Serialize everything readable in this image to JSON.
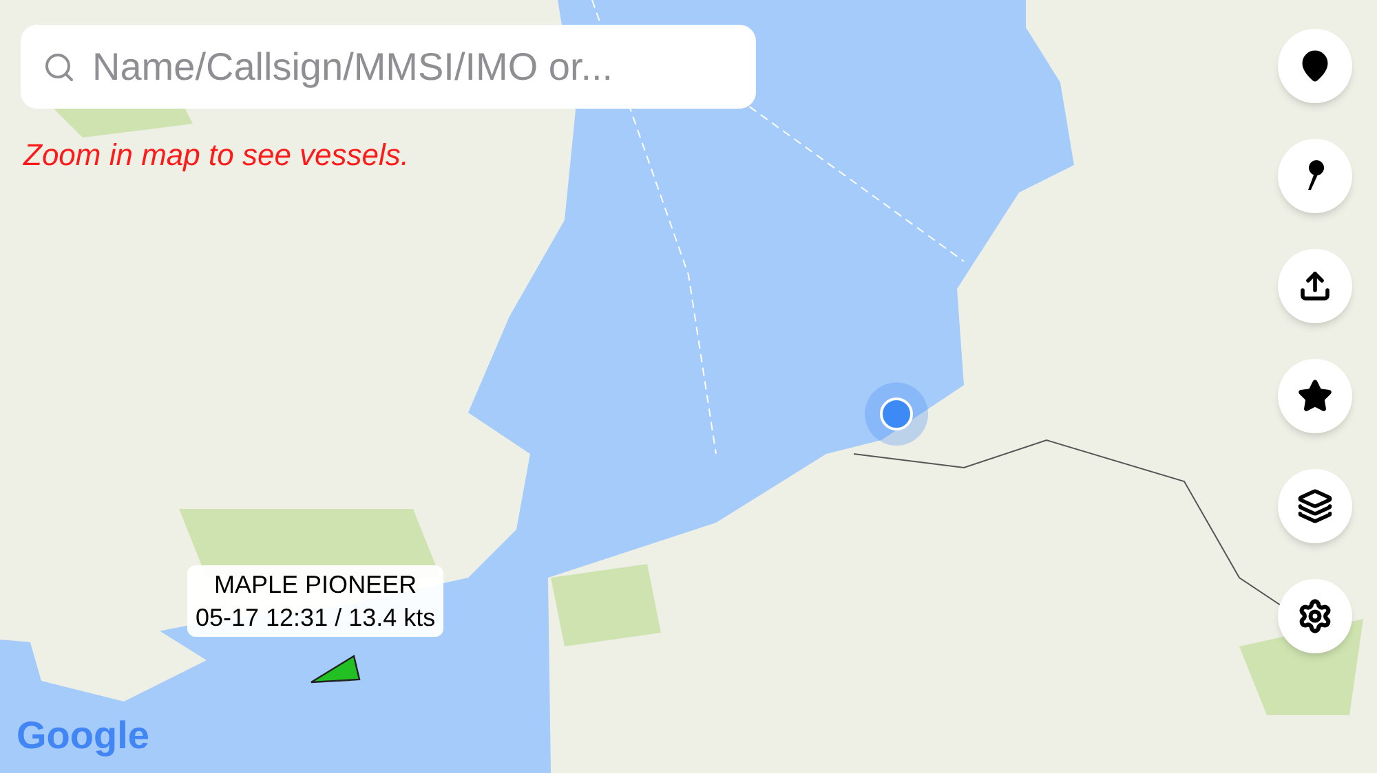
{
  "search": {
    "placeholder": "Name/Callsign/MMSI/IMO or..."
  },
  "notice": "Zoom in map to see vessels.",
  "vessel": {
    "name": "MAPLE PIONEER",
    "info": "05-17 12:31 / 13.4 kts"
  },
  "attribution": "Google"
}
